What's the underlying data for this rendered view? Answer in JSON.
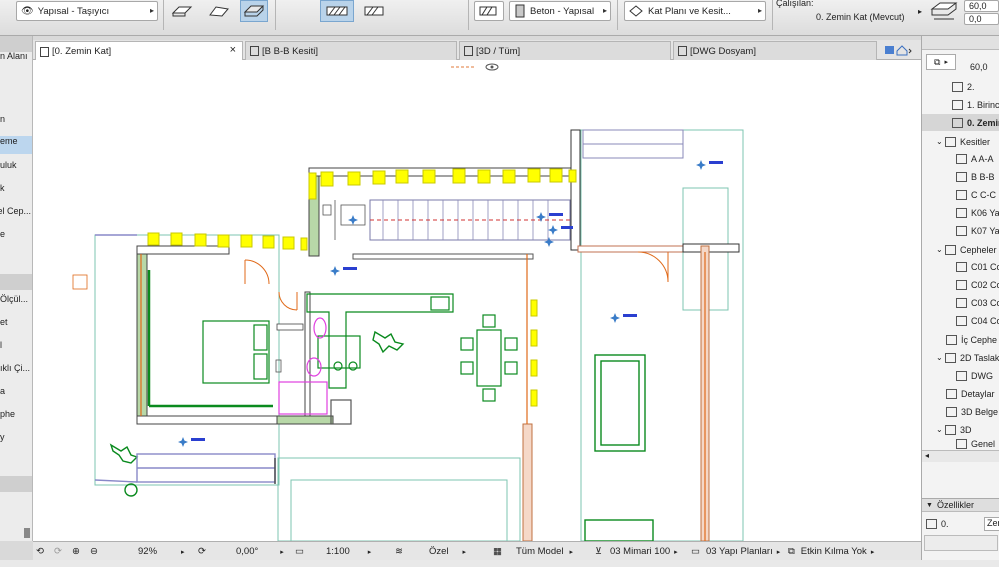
{
  "top_bar": {
    "layer_combo": "Yapısal - Taşıyıcı",
    "material_combo": "Beton - Yapısal",
    "view_combo": "Kat Planı ve Kesit...",
    "working_label": "Çalışılan:",
    "story_value": "0. Zemin Kat (Mevcut)",
    "height_top": "60,0",
    "height_bottom": "0,0"
  },
  "tabs": [
    {
      "label": "[0. Zemin Kat]"
    },
    {
      "label": "[B B-B Kesiti]"
    },
    {
      "label": "[3D / Tüm]"
    },
    {
      "label": "[DWG Dosyam]"
    }
  ],
  "toolbox": {
    "items": [
      "n Alanı",
      "n",
      "eme",
      "uluk",
      "k",
      "el Cep...",
      "e",
      "Ölçül...",
      "et",
      "l",
      "ıklı Çi...",
      "a",
      "phe",
      "y"
    ]
  },
  "navigator": {
    "rows": [
      {
        "label": "60,0"
      },
      {
        "label": "2."
      },
      {
        "label": "1. Birinci"
      },
      {
        "label": "0. Zemin"
      },
      {
        "label": "Kesitler"
      },
      {
        "label": "A A-A"
      },
      {
        "label": "B B-B"
      },
      {
        "label": "C C-C"
      },
      {
        "label": "K06 Ya"
      },
      {
        "label": "K07 Ya"
      },
      {
        "label": "Cepheler"
      },
      {
        "label": "C01 Co"
      },
      {
        "label": "C02 Co"
      },
      {
        "label": "C03 Co"
      },
      {
        "label": "C04 Co"
      },
      {
        "label": "İç Cephe"
      },
      {
        "label": "2D Taslak"
      },
      {
        "label": "DWG"
      },
      {
        "label": "Detaylar"
      },
      {
        "label": "3D Belge"
      },
      {
        "label": "3D"
      },
      {
        "label": "Genel"
      }
    ],
    "properties_title": "Özellikler",
    "properties_id": "0.",
    "properties_value": "Zem"
  },
  "status_bar": {
    "zoom": "92%",
    "angle": "0,00°",
    "scale": "1:100",
    "pen_set": "Özel",
    "model_view": "Tüm Model",
    "layer_combo": "03 Mimari 100",
    "dim_combo": "03 Yapı Planları",
    "renovation": "Etkin Kılma Yok"
  },
  "colors": {
    "accent_blue": "#bcd6ee",
    "wall_fill": "#b8d8a8",
    "highlight_yellow": "#ffff00",
    "furniture_green": "#0a8a1e",
    "zone_teal": "#7cc4b0",
    "orange_line": "#e06a1a",
    "label_blue": "#2a3fd0"
  }
}
